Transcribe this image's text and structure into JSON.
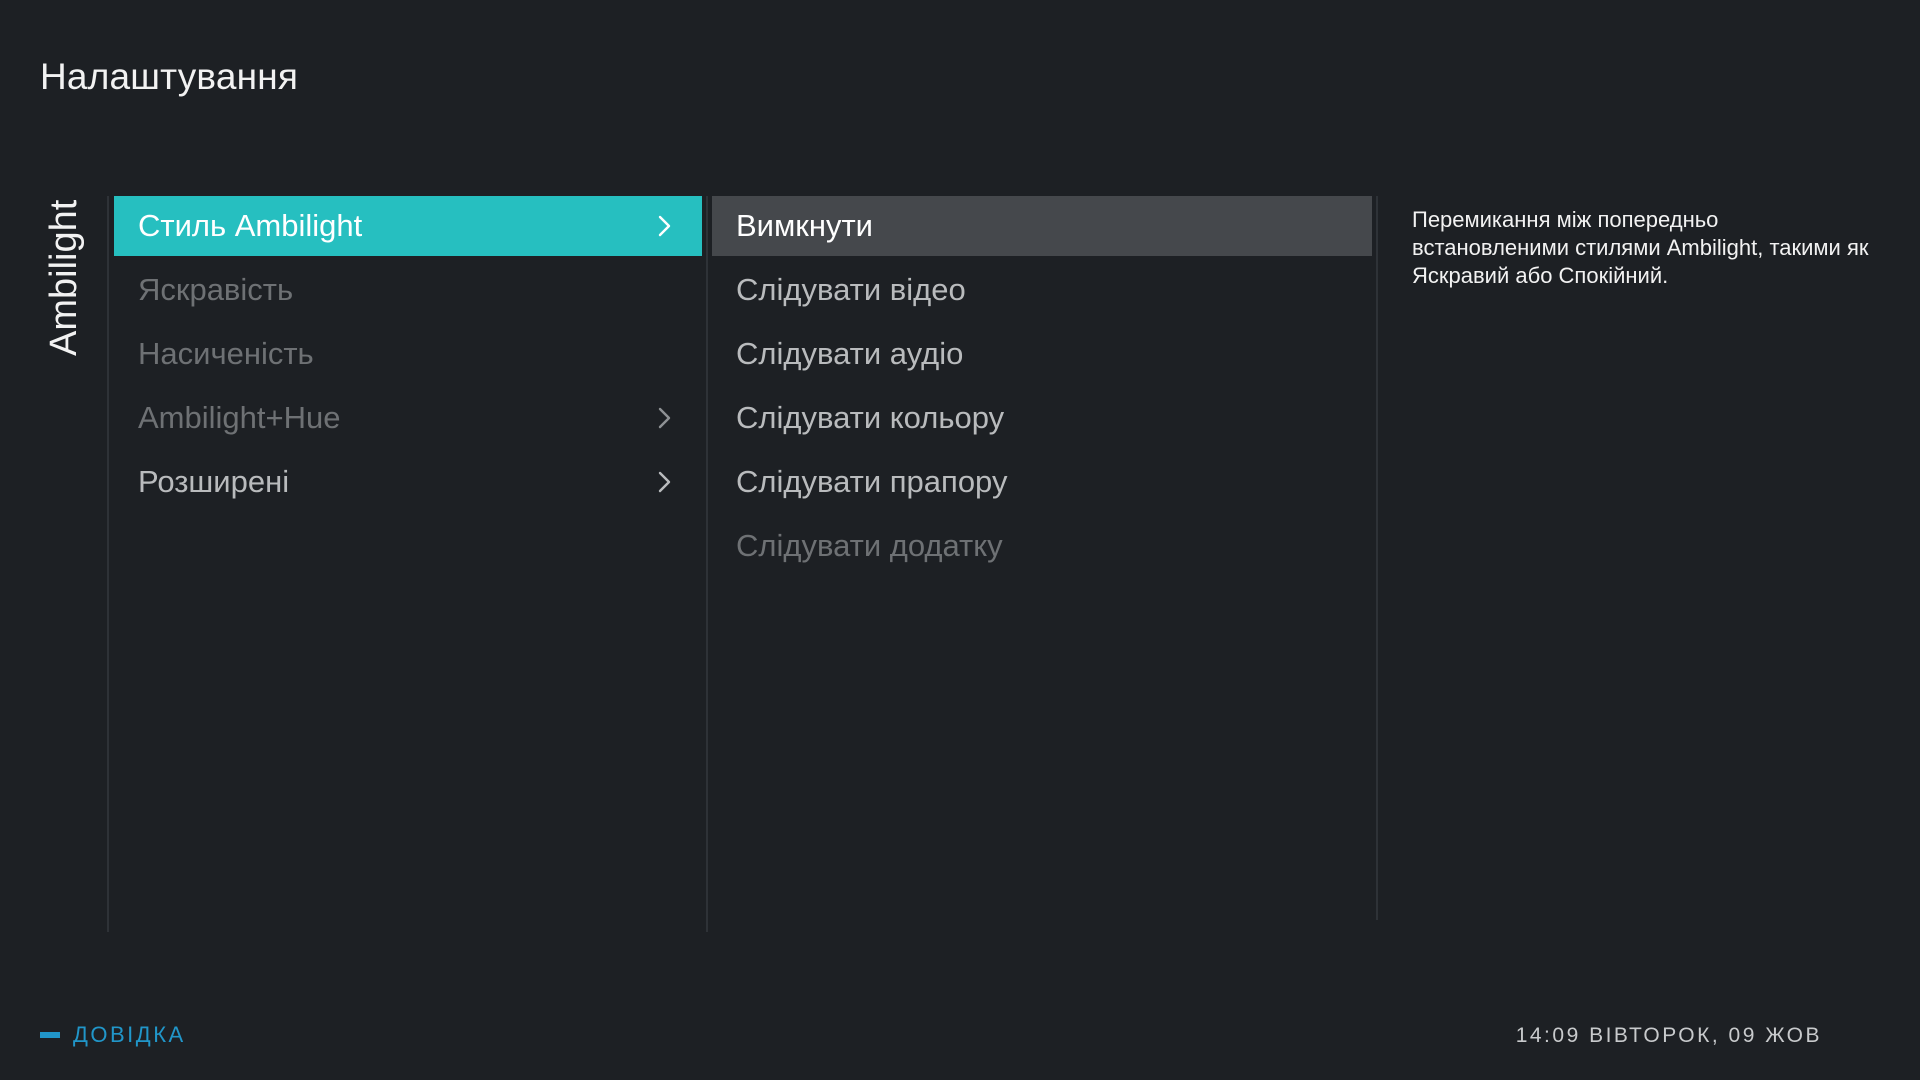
{
  "page": {
    "title": "Налаштування"
  },
  "section": {
    "label": "Ambilight"
  },
  "menu": {
    "items": [
      {
        "label": "Стиль Ambilight",
        "state": "active",
        "has_submenu": true
      },
      {
        "label": "Яскравість",
        "state": "dim",
        "has_submenu": false
      },
      {
        "label": "Насиченість",
        "state": "dim",
        "has_submenu": false
      },
      {
        "label": "Ambilight+Hue",
        "state": "dim",
        "has_submenu": true
      },
      {
        "label": "Розширені",
        "state": "normal",
        "has_submenu": true
      }
    ]
  },
  "submenu": {
    "items": [
      {
        "label": "Вимкнути",
        "state": "selected"
      },
      {
        "label": "Слідувати відео",
        "state": "normal"
      },
      {
        "label": "Слідувати аудіо",
        "state": "normal"
      },
      {
        "label": "Слідувати кольору",
        "state": "normal"
      },
      {
        "label": "Слідувати прапору",
        "state": "normal"
      },
      {
        "label": "Слідувати додатку",
        "state": "dim"
      }
    ]
  },
  "description": {
    "text": "Перемикання між попередньо встановленими стилями Ambilight, такими як Яскравий або Спокійний."
  },
  "footer": {
    "help_label": "ДОВІДКА",
    "clock": "14:09 ВІВТОРОК, 09 ЖОВ"
  },
  "colors": {
    "background": "#1d2024",
    "accent": "#26bfc0",
    "selected": "#45484c",
    "help": "#2196c9"
  },
  "icons": {
    "submenu": "chevron-right-icon",
    "help": "minus-key-icon"
  }
}
